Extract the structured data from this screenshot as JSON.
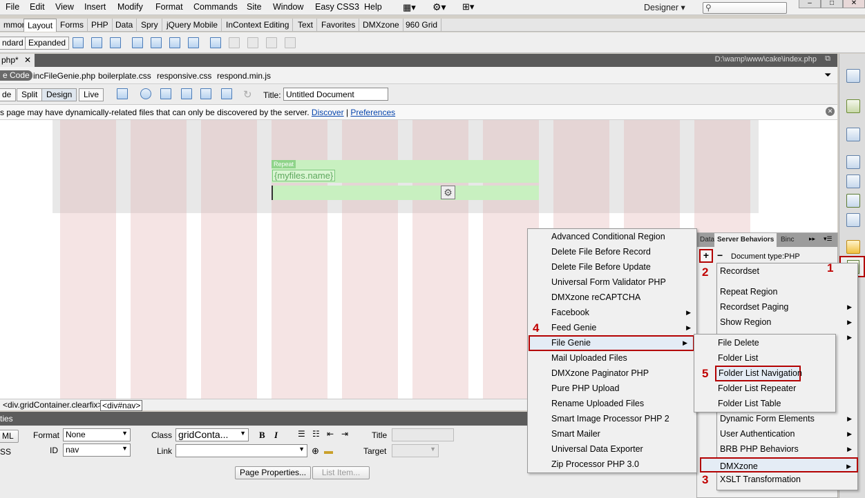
{
  "menubar": {
    "items": [
      "File",
      "Edit",
      "View",
      "Insert",
      "Modify",
      "Format",
      "Commands",
      "Site",
      "Window",
      "Easy CSS3",
      "Help"
    ],
    "workspace": "Designer",
    "window_controls": [
      "–",
      "□",
      "✕"
    ]
  },
  "insert_tabs": [
    "mmon",
    "Layout",
    "Forms",
    "PHP",
    "Data",
    "Spry",
    "jQuery Mobile",
    "InContext Editing",
    "Text",
    "Favorites",
    "DMXzone",
    "960 Grid"
  ],
  "insert_toolbar": {
    "standard": "ndard",
    "expanded": "Expanded"
  },
  "document": {
    "tab": "php*",
    "path": "D:\\wamp\\www\\cake\\index.php",
    "source_code": "e Code",
    "related_files": [
      "incFileGenie.php",
      "boilerplate.css",
      "responsive.css",
      "respond.min.js"
    ],
    "views": [
      "de",
      "Split",
      "Design",
      "Live"
    ],
    "title_label": "Title:",
    "title_value": "Untitled Document"
  },
  "infobar": {
    "message": "s page may have dynamically-related files that can only be discovered by the server.",
    "discover": "Discover",
    "separator": "|",
    "preferences": "Preferences"
  },
  "canvas": {
    "repeat_label": "Repeat",
    "binding": "{myfiles.name}"
  },
  "tag_selector": {
    "container": "<div.gridContainer.clearfix>",
    "nav": "<div#nav>"
  },
  "properties": {
    "title": "ties",
    "html_btn": "ML",
    "css_btn": "SS",
    "format_label": "Format",
    "format_value": "None",
    "class_label": "Class",
    "class_value": "gridConta...",
    "id_label": "ID",
    "id_value": "nav",
    "link_label": "Link",
    "title_label": "Title",
    "target_label": "Target",
    "page_properties": "Page Properties...",
    "list_item": "List Item..."
  },
  "server_behaviors": {
    "tabs": [
      "Data",
      "Server Behaviors",
      "Binc"
    ],
    "doc_type": "Document type:PHP",
    "plus": "+",
    "minus": "−"
  },
  "sb_menu": [
    {
      "label": "Recordset",
      "sub": false
    },
    {
      "label": "",
      "sub": false
    },
    {
      "label": "Repeat Region",
      "sub": false
    },
    {
      "label": "Recordset Paging",
      "sub": true
    },
    {
      "label": "Show Region",
      "sub": true
    },
    {
      "label": "",
      "sub": true
    },
    {
      "label": "",
      "sub": false
    },
    {
      "label": "",
      "sub": false
    },
    {
      "label": "",
      "sub": false
    },
    {
      "label": "",
      "sub": false
    },
    {
      "label": "Dynamic Form Elements",
      "sub": true
    },
    {
      "label": "User Authentication",
      "sub": true
    },
    {
      "label": "BRB PHP Behaviors",
      "sub": true
    },
    {
      "label": "DMXzone",
      "sub": true
    },
    {
      "label": "XSLT Transformation",
      "sub": false
    }
  ],
  "main_menu": [
    {
      "label": "Advanced Conditional Region",
      "sub": false
    },
    {
      "label": "Delete File Before Record",
      "sub": false
    },
    {
      "label": "Delete File Before Update",
      "sub": false
    },
    {
      "label": "Universal Form Validator PHP",
      "sub": false
    },
    {
      "label": "DMXzone reCAPTCHA",
      "sub": false
    },
    {
      "label": "Facebook",
      "sub": true
    },
    {
      "label": "Feed Genie",
      "sub": true
    },
    {
      "label": "File Genie",
      "sub": true
    },
    {
      "label": "Mail Uploaded Files",
      "sub": false
    },
    {
      "label": "DMXzone Paginator PHP",
      "sub": false
    },
    {
      "label": "Pure PHP Upload",
      "sub": false
    },
    {
      "label": "Rename Uploaded Files",
      "sub": false
    },
    {
      "label": "Smart Image Processor PHP 2",
      "sub": false
    },
    {
      "label": "Smart Mailer",
      "sub": false
    },
    {
      "label": "Universal Data Exporter",
      "sub": false
    },
    {
      "label": "Zip Processor PHP 3.0",
      "sub": false
    }
  ],
  "file_genie_menu": [
    "File Delete",
    "Folder List",
    "Folder List Navigation",
    "Folder List Repeater",
    "Folder List Table"
  ],
  "step_numbers": [
    "1",
    "2",
    "3",
    "4",
    "5"
  ],
  "colors": {
    "highlight": "#b30000",
    "step_number": "#c00000",
    "repeat_region": "#c8f0c0",
    "grid_column": "#f5e4e4"
  },
  "icons": {
    "view_mode": "view-mode-icon",
    "settings": "gear-icon",
    "sitemap": "sitemap-icon",
    "search": "search-icon",
    "filter": "filter-icon",
    "close": "close-icon",
    "server_behavior": "server-behavior-icon",
    "php_obj": "php-object-icon"
  }
}
